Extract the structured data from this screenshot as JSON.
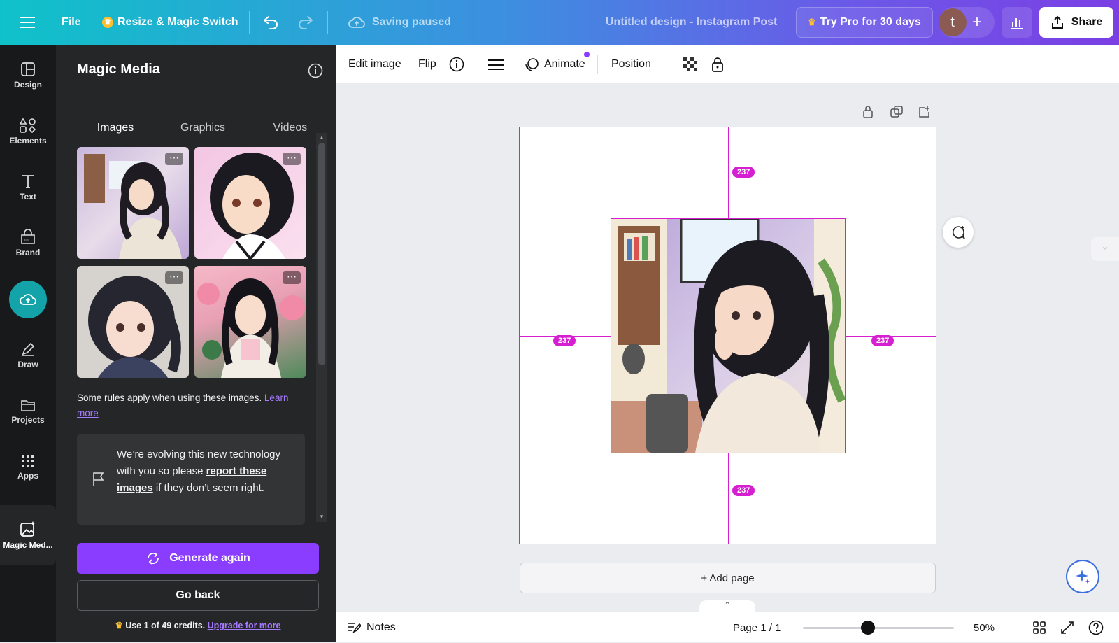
{
  "topbar": {
    "file_label": "File",
    "resize_label": "Resize & Magic Switch",
    "saving_status": "Saving paused",
    "design_title": "Untitled design - Instagram Post",
    "try_pro_label": "Try Pro for 30 days",
    "avatar_initial": "t",
    "share_label": "Share"
  },
  "rail": {
    "items": [
      {
        "label": "Design"
      },
      {
        "label": "Elements"
      },
      {
        "label": "Text"
      },
      {
        "label": "Brand"
      },
      {
        "label": ""
      },
      {
        "label": "Draw"
      },
      {
        "label": "Projects"
      },
      {
        "label": "Apps"
      },
      {
        "label": "Magic Med..."
      }
    ]
  },
  "panel": {
    "title": "Magic Media",
    "tabs": [
      {
        "label": "Images"
      },
      {
        "label": "Graphics"
      },
      {
        "label": "Videos"
      }
    ],
    "rules_text": "Some rules apply when using these images.",
    "learn_more": "Learn more",
    "notice_pre": "We’re evolving this new technology with you so please",
    "notice_link": "report these images",
    "notice_post": "if they don’t seem right.",
    "generate_again": "Generate again",
    "go_back": "Go back",
    "credits_text": "Use 1 of 49 credits.",
    "upgrade_link": "Upgrade for more"
  },
  "toolbar": {
    "edit_image": "Edit image",
    "flip": "Flip",
    "animate": "Animate",
    "position": "Position"
  },
  "canvas": {
    "spacing": {
      "top": "237",
      "left": "237",
      "right": "237",
      "bottom": "237"
    },
    "add_page": "+ Add page"
  },
  "bottombar": {
    "notes": "Notes",
    "page_indicator": "Page 1 / 1",
    "zoom_level": "50%",
    "zoom_fraction": 0.43
  },
  "colors": {
    "accent": "#8b3dff",
    "guide": "#d61fd0",
    "panel_bg": "#252627",
    "rail_bg": "#18191b"
  }
}
